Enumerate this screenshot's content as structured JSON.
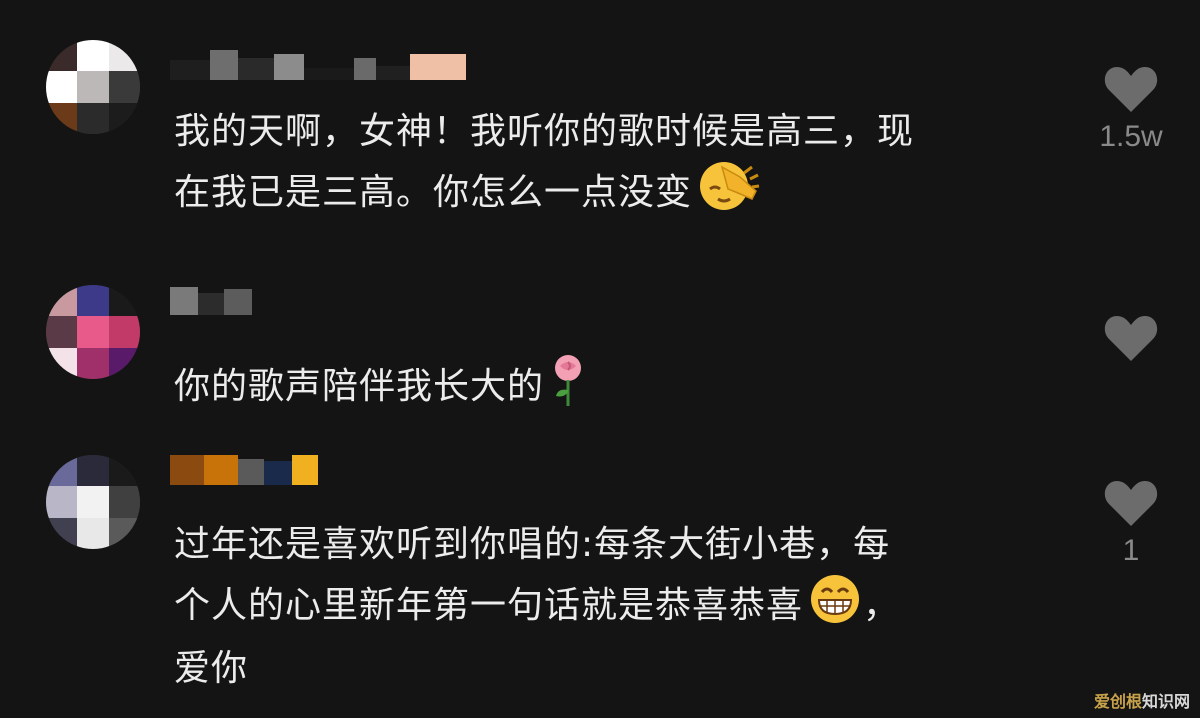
{
  "comments": [
    {
      "text_lines": [
        "我的天啊，女神！我听你的歌时候是高三，现",
        "在我已是三高。你怎么一点没变"
      ],
      "emoji": "face-palm-icon",
      "likes": "1.5w",
      "avatar_tiles": [
        "#3b2a2a",
        "#ffffff",
        "#ece9ea",
        "#ffffff",
        "#bdb8b8",
        "#3a3a3a",
        "#6b3a18",
        "#2b2b2b",
        "#1c1c1c"
      ],
      "username_tiles": [
        "#1e1e1e",
        "#6e6e6e",
        "#2a2a2a",
        "#8c8c8c",
        "#1a1a1a",
        "#6a6a6a",
        "#202020",
        "#f0c0a6"
      ]
    },
    {
      "text_lines": [
        "你的歌声陪伴我长大的"
      ],
      "emoji": "rose-icon",
      "likes": "",
      "avatar_tiles": [
        "#c89aa0",
        "#3d3a8a",
        "#1a1a1a",
        "#5a3a46",
        "#e85a8a",
        "#c23a68",
        "#f3e3e8",
        "#a0306a",
        "#5a1a6a"
      ],
      "username_tiles": [
        "#7a7a7a",
        "#2c2c2c",
        "#5c5c5c"
      ]
    },
    {
      "text_lines": [
        "过年还是喜欢听到你唱的:每条大街小巷，每",
        "个人的心里新年第一句话就是恭喜恭喜",
        "爱你"
      ],
      "emoji": "grinning-face-icon",
      "line2_suffix": "，",
      "likes": "1",
      "avatar_tiles": [
        "#6a6a9a",
        "#2a2a3a",
        "#1a1a1a",
        "#b9b6c8",
        "#f2f2f2",
        "#404040",
        "#404050",
        "#e8e8e8",
        "#5a5a5a"
      ],
      "username_tiles": [
        "#8a4a10",
        "#c8720a",
        "#5a5a5a",
        "#1a2a4a",
        "#f0b020"
      ]
    }
  ],
  "watermark": {
    "brand": "爱创根",
    "suffix": "知识网"
  }
}
